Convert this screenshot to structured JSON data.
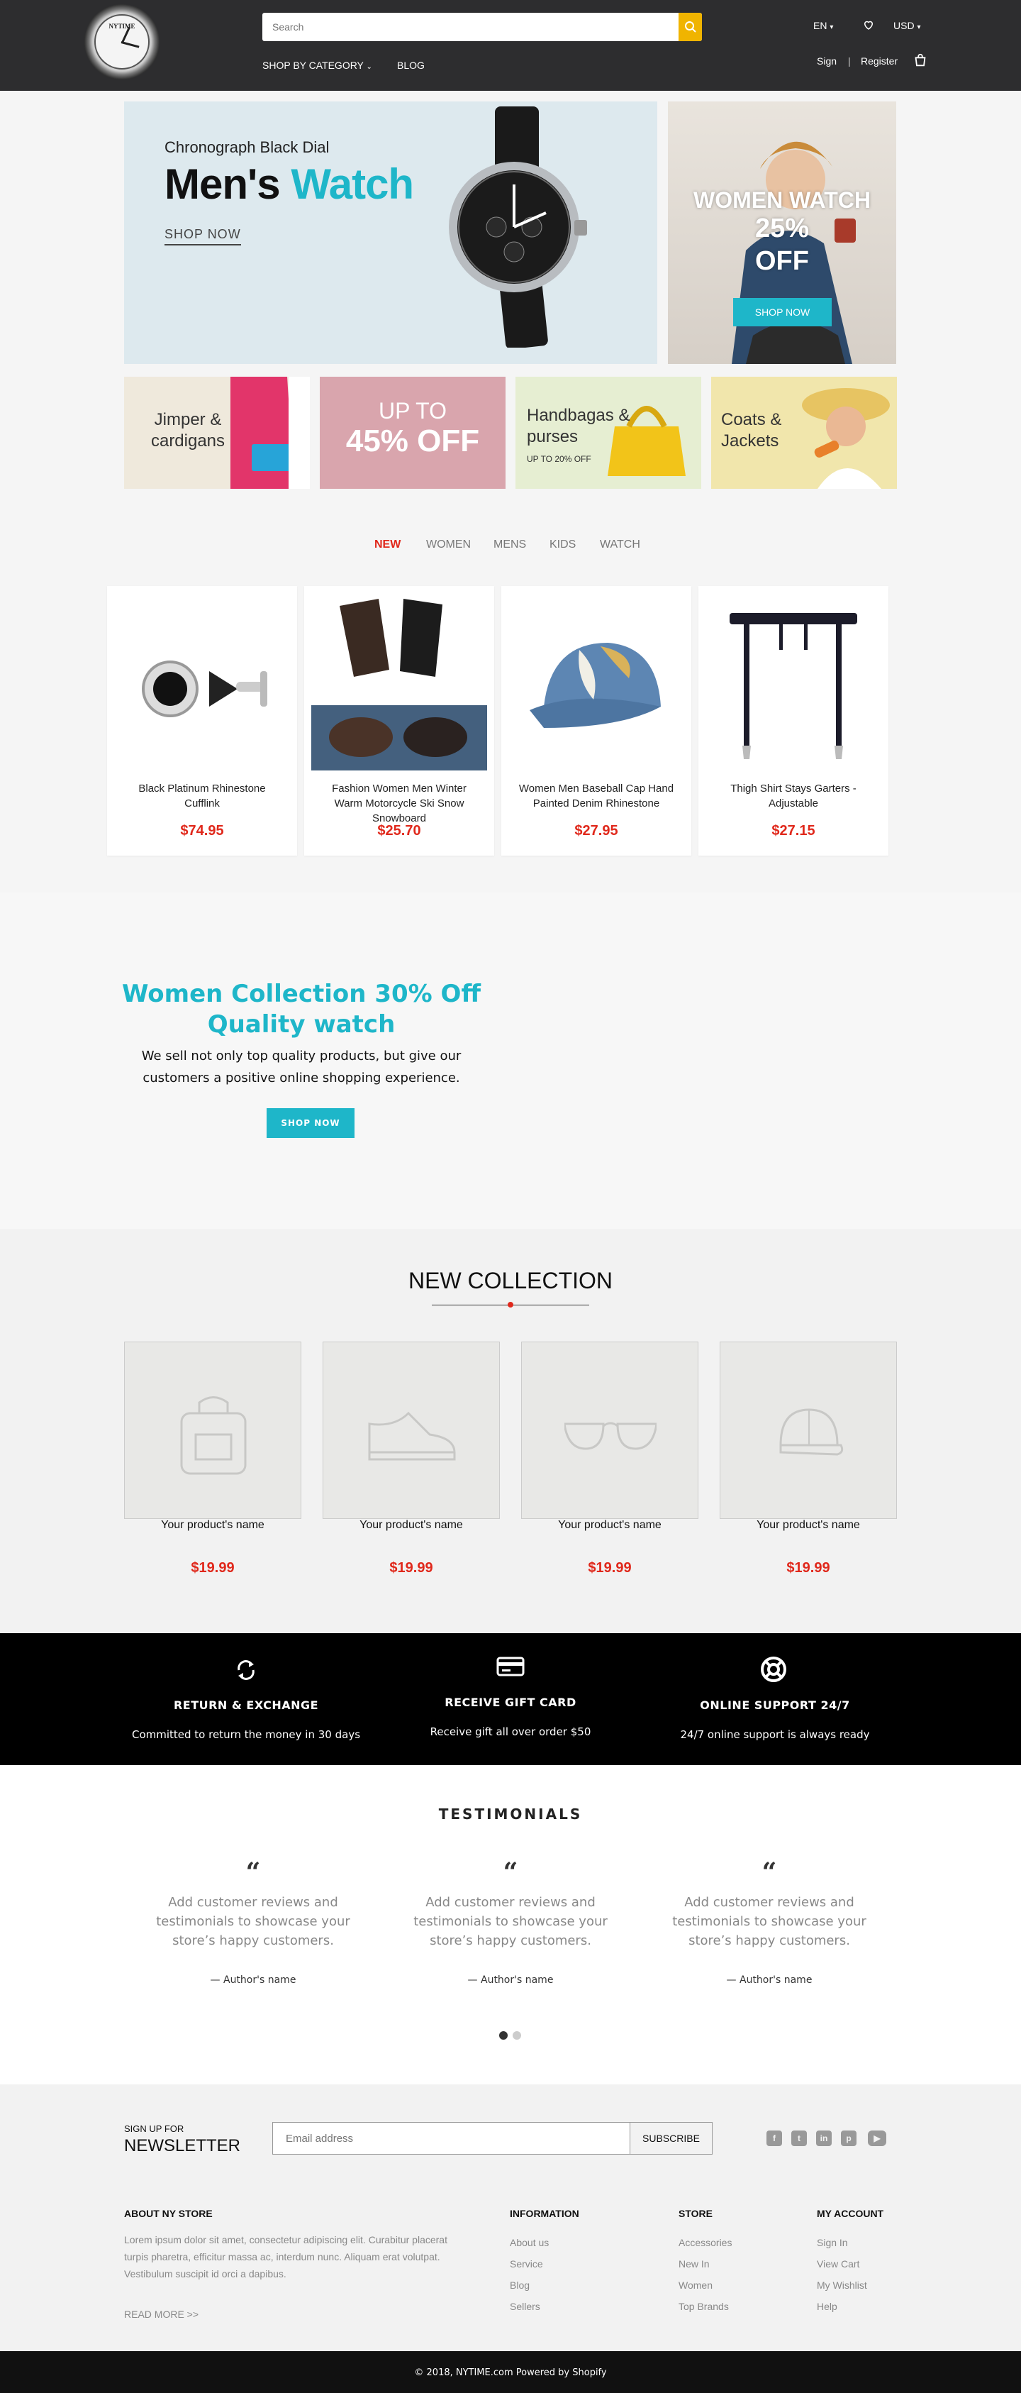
{
  "header": {
    "logo_text": "NYTIME",
    "search_placeholder": "Search",
    "nav_category": "SHOP BY CATEGORY",
    "nav_blog": "BLOG",
    "language": "EN",
    "currency": "USD",
    "sign": "Sign",
    "separator": "|",
    "register": "Register"
  },
  "hero": {
    "subtitle": "Chronograph Black Dial",
    "title_a": "Men's",
    "title_b": "Watch",
    "shop_now": "SHOP NOW",
    "side_line1": "WOMEN WATCH",
    "side_line2": "25%",
    "side_line3": "OFF",
    "side_btn": "SHOP NOW"
  },
  "banners": {
    "b1_line1": "Jimper &",
    "b1_line2": "cardigans",
    "b2_line1": "UP TO",
    "b2_line2": "45% OFF",
    "b3_line1": "Handbagas &",
    "b3_line2": "purses",
    "b3_small": "UP TO 20% OFF",
    "b4_line1": "Coats &",
    "b4_line2": "Jackets"
  },
  "tabs": [
    "NEW",
    "WOMEN",
    "MENS",
    "KIDS",
    "WATCH"
  ],
  "products": [
    {
      "name": "Black Platinum Rhinestone Cufflink",
      "price": "$74.95"
    },
    {
      "name": "Fashion Women Men Winter Warm Motorcycle Ski Snow Snowboard",
      "price": "$25.70"
    },
    {
      "name": "Women Men Baseball Cap Hand Painted Denim Rhinestone",
      "price": "$27.95"
    },
    {
      "name": "Thigh Shirt Stays Garters - Adjustable",
      "price": "$27.15"
    }
  ],
  "promo": {
    "title": "Women Collection 30% Off Quality watch",
    "text": "We sell not only top quality products, but give our customers a positive online shopping experience.",
    "button": "SHOP NOW"
  },
  "new_collection": {
    "title": "NEW COLLECTION",
    "items": [
      {
        "name": "Your product's name",
        "price": "$19.99"
      },
      {
        "name": "Your product's name",
        "price": "$19.99"
      },
      {
        "name": "Your product's name",
        "price": "$19.99"
      },
      {
        "name": "Your product's name",
        "price": "$19.99"
      }
    ]
  },
  "features": [
    {
      "title": "RETURN & EXCHANGE",
      "text": "Committed to return the money in 30 days",
      "icon": "refresh-icon"
    },
    {
      "title": "RECEIVE GIFT CARD",
      "text": "Receive gift all over order $50",
      "icon": "card-icon"
    },
    {
      "title": "ONLINE SUPPORT 24/7",
      "text": "24/7 online support is always ready",
      "icon": "lifebuoy-icon"
    }
  ],
  "testimonials": {
    "title": "TESTIMONIALS",
    "quote_mark": "“",
    "items": [
      {
        "text": "Add customer reviews and testimonials to showcase your store’s happy customers.",
        "author": "— Author's name"
      },
      {
        "text": "Add customer reviews and testimonials to showcase your store’s happy customers.",
        "author": "— Author's name"
      },
      {
        "text": "Add customer reviews and testimonials to showcase your store’s happy customers.",
        "author": "— Author's name"
      }
    ]
  },
  "footer": {
    "newsletter_small": "SIGN UP FOR",
    "newsletter_big": "NEWSLETTER",
    "email_placeholder": "Email address",
    "subscribe": "SUBSCRIBE",
    "about_title": "ABOUT NY STORE",
    "about_text": "Lorem ipsum dolor sit amet, consectetur adipiscing elit. Curabitur placerat turpis pharetra, efficitur massa ac, interdum nunc. Aliquam erat volutpat. Vestibulum suscipit id orci a dapibus.",
    "read_more": "READ MORE >>",
    "info_title": "INFORMATION",
    "info_links": [
      "About us",
      "Service",
      "Blog",
      "Sellers"
    ],
    "store_title": "STORE",
    "store_links": [
      "Accessories",
      "New In",
      "Women",
      "Top Brands"
    ],
    "account_title": "MY ACCOUNT",
    "account_links": [
      "Sign In",
      "View Cart",
      "My Wishlist",
      "Help"
    ],
    "copyright": "© 2018, NYTIME.com Powered by Shopify"
  },
  "colors": {
    "accent": "#1eb6c9",
    "price": "#e0281b",
    "header": "#2d2d2f",
    "search_button": "#f0b400"
  }
}
